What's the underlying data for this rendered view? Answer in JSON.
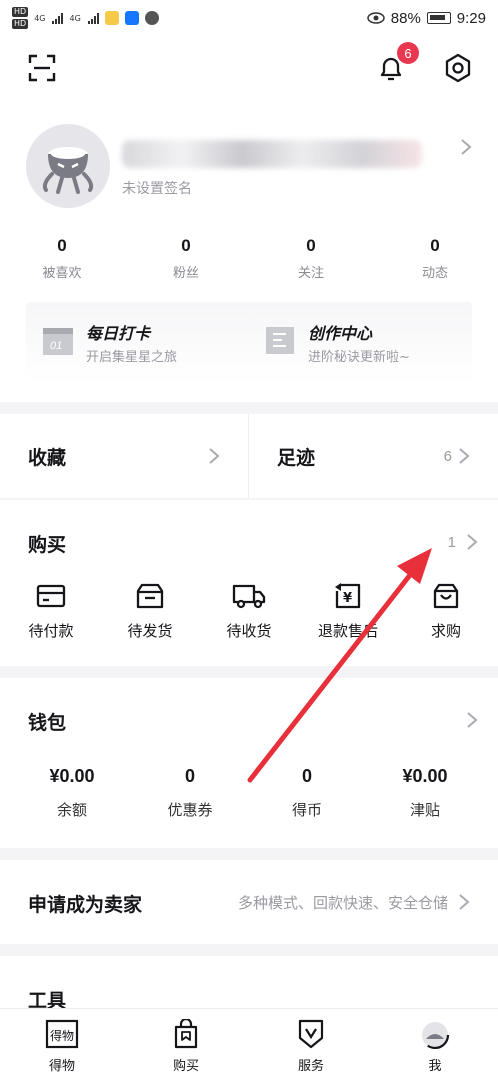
{
  "status_bar": {
    "network_1": "4G",
    "network_2": "4G",
    "battery": "88%",
    "time": "9:29"
  },
  "header": {
    "notification_count": "6",
    "scan_icon": "scan-icon",
    "bell_icon": "bell-icon",
    "settings_icon": "settings-icon"
  },
  "profile": {
    "signature": "未设置签名"
  },
  "stats": [
    {
      "value": "0",
      "label": "被喜欢"
    },
    {
      "value": "0",
      "label": "粉丝"
    },
    {
      "value": "0",
      "label": "关注"
    },
    {
      "value": "0",
      "label": "动态"
    }
  ],
  "promo": {
    "checkin": {
      "title": "每日打卡",
      "subtitle": "开启集星星之旅",
      "icon_text": "01"
    },
    "creator": {
      "title": "创作中心",
      "subtitle": "进阶秘诀更新啦~"
    }
  },
  "collect": {
    "label": "收藏"
  },
  "history": {
    "label": "足迹",
    "count": "6"
  },
  "purchase": {
    "title": "购买",
    "count": "1",
    "items": [
      {
        "label": "待付款",
        "icon": "card-icon"
      },
      {
        "label": "待发货",
        "icon": "box-icon"
      },
      {
        "label": "待收货",
        "icon": "truck-icon"
      },
      {
        "label": "退款售后",
        "icon": "refund-icon"
      },
      {
        "label": "求购",
        "icon": "bag-icon"
      }
    ]
  },
  "wallet": {
    "title": "钱包",
    "items": [
      {
        "value": "¥0.00",
        "label": "余额"
      },
      {
        "value": "0",
        "label": "优惠券"
      },
      {
        "value": "0",
        "label": "得币"
      },
      {
        "value": "¥0.00",
        "label": "津贴"
      }
    ]
  },
  "seller": {
    "title": "申请成为卖家",
    "hint": "多种模式、回款快速、安全仓储"
  },
  "tools": {
    "title": "工具"
  },
  "bottom_nav": [
    {
      "label": "得物",
      "icon_text": "得物"
    },
    {
      "label": "购买"
    },
    {
      "label": "服务"
    },
    {
      "label": "我"
    }
  ],
  "colors": {
    "badge": "#e8384f",
    "annotation_arrow": "#e8303a",
    "text_primary": "#16161a",
    "text_secondary": "#9a9aa3"
  }
}
